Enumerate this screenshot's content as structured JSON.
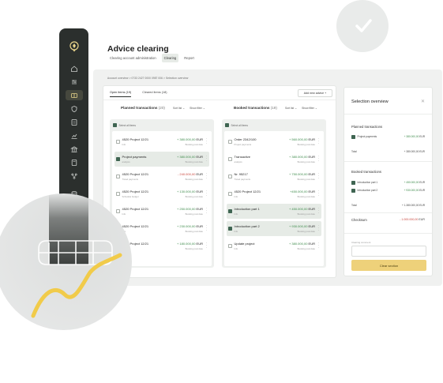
{
  "page": {
    "title": "Advice clearing",
    "top_nav": [
      "Clearing account administration",
      "Clearing",
      "Report"
    ],
    "breadcrumb": "Account overview  >  0733 2427 0000 0987 006  >  Selection overview"
  },
  "sidebar": {
    "icons": [
      "logo-icon",
      "home-icon",
      "sliders-icon",
      "wallet-icon",
      "shield-icon",
      "document-icon",
      "chart-icon",
      "building-icon",
      "calculator-icon",
      "network-icon",
      "database-icon",
      "user-icon",
      "power-icon"
    ]
  },
  "lists": {
    "tabs": [
      "Open items (19)",
      "Cleared items (18)"
    ],
    "add_button": "Add new advice +",
    "planned": {
      "title": "Planned transactions",
      "count": "(20)",
      "sort": "Sort list ⌄",
      "filter": "Show filter ⌄",
      "select_all": "Select all items",
      "rows": [
        {
          "name": "4520 Project 12/21",
          "sub": "Info",
          "amount": "+ 380.000,00",
          "currency": "EUR",
          "sub_amt": "Booking post date",
          "sign": "pos",
          "checked": false,
          "hl": false
        },
        {
          "name": "Project payments",
          "sub": "analysis",
          "amount": "+ 380.000,00",
          "currency": "EUR",
          "sub_amt": "Booking post date",
          "sign": "pos",
          "checked": true,
          "hl": true
        },
        {
          "name": "4520 Project 12/21",
          "sub": "Travel payments",
          "amount": "- 240.000,00",
          "currency": "EUR",
          "sub_amt": "Booking post date",
          "sign": "neg",
          "checked": false,
          "hl": false
        },
        {
          "name": "4520 Project 12/21",
          "sub": "Schedule budget",
          "amount": "+ 130.000,00",
          "currency": "EUR",
          "sub_amt": "Booking post date",
          "sign": "pos",
          "checked": false,
          "hl": false
        },
        {
          "name": "4520 Project 12/21",
          "sub": "Info",
          "amount": "+ 250.000,00",
          "currency": "EUR",
          "sub_amt": "Booking post date",
          "sign": "pos",
          "checked": false,
          "hl": false
        },
        {
          "name": "4520 Project 12/21",
          "sub": "Info",
          "amount": "+ 230.000,00",
          "currency": "EUR",
          "sub_amt": "Booking post date",
          "sign": "pos",
          "checked": false,
          "hl": false
        },
        {
          "name": "4520 Project 12/21",
          "sub": "Info",
          "amount": "+ 180.000,00",
          "currency": "EUR",
          "sub_amt": "Booking post date",
          "sign": "pos",
          "checked": false,
          "hl": false
        }
      ]
    },
    "booked": {
      "title": "Booked transactions",
      "count": "(19)",
      "sort": "Sort list ⌄",
      "filter": "Show filter ⌄",
      "select_all": "Select all items",
      "rows": [
        {
          "name": "Order 2342/100",
          "sub": "Project payments",
          "amount": "+ 560.000,00",
          "currency": "EUR",
          "sub_amt": "Booking post date",
          "sign": "pos",
          "checked": false,
          "hl": false
        },
        {
          "name": "Transactive",
          "sub": "analysis",
          "amount": "+ 380.000,00",
          "currency": "EUR",
          "sub_amt": "Booking post date",
          "sign": "pos",
          "checked": false,
          "hl": false
        },
        {
          "name": "Nr. 95217",
          "sub": "Travel payments",
          "amount": "+ 750.000,00",
          "currency": "EUR",
          "sub_amt": "Booking post date",
          "sign": "pos",
          "checked": false,
          "hl": false
        },
        {
          "name": "4520 Project 12/21",
          "sub": "Info",
          "amount": "+450.000,00",
          "currency": "EUR",
          "sub_amt": "Booking post date",
          "sign": "pos",
          "checked": false,
          "hl": false
        },
        {
          "name": "Introduction part 1",
          "sub": "Info",
          "amount": "+ 450.000,00",
          "currency": "EUR",
          "sub_amt": "Booking post date",
          "sign": "pos",
          "checked": true,
          "hl": true
        },
        {
          "name": "Introduction part 2",
          "sub": "Info",
          "amount": "+ 930.000,00",
          "currency": "EUR",
          "sub_amt": "Booking post date",
          "sign": "pos",
          "checked": true,
          "hl": true
        },
        {
          "name": "Update project",
          "sub": "Info",
          "amount": "+ 380.000,00",
          "currency": "EUR",
          "sub_amt": "Booking post date",
          "sign": "pos",
          "checked": false,
          "hl": false
        }
      ]
    }
  },
  "overview": {
    "title": "Selection overview",
    "close": "✕",
    "planned_title": "Planned transactions",
    "planned_items": [
      {
        "label": "Project payments",
        "value": "+ 380.000,00",
        "currency": "EUR"
      }
    ],
    "planned_total_label": "Total",
    "planned_total": "+ 380.000,00 EUR",
    "booked_title": "Booked transactions",
    "booked_items": [
      {
        "label": "Introduction part 1",
        "value": "+ 450.000,00",
        "currency": "EUR"
      },
      {
        "label": "Introduction part 2",
        "value": "+ 930.000,00",
        "currency": "EUR"
      }
    ],
    "booked_total_label": "Total",
    "booked_total": "+ 1.380.000,00 EUR",
    "checksum_label": "Checksum",
    "checksum_value": "- 1.000.000,00",
    "checksum_currency": "EUR",
    "clearing_label": "Clearing comment",
    "clear_button": "Clear section"
  },
  "colors": {
    "accent": "#eed17a",
    "sidebar": "#2b2f2d",
    "positive": "#3c8a4a",
    "negative": "#c9463c",
    "chart_line": "#f1cb4a"
  }
}
